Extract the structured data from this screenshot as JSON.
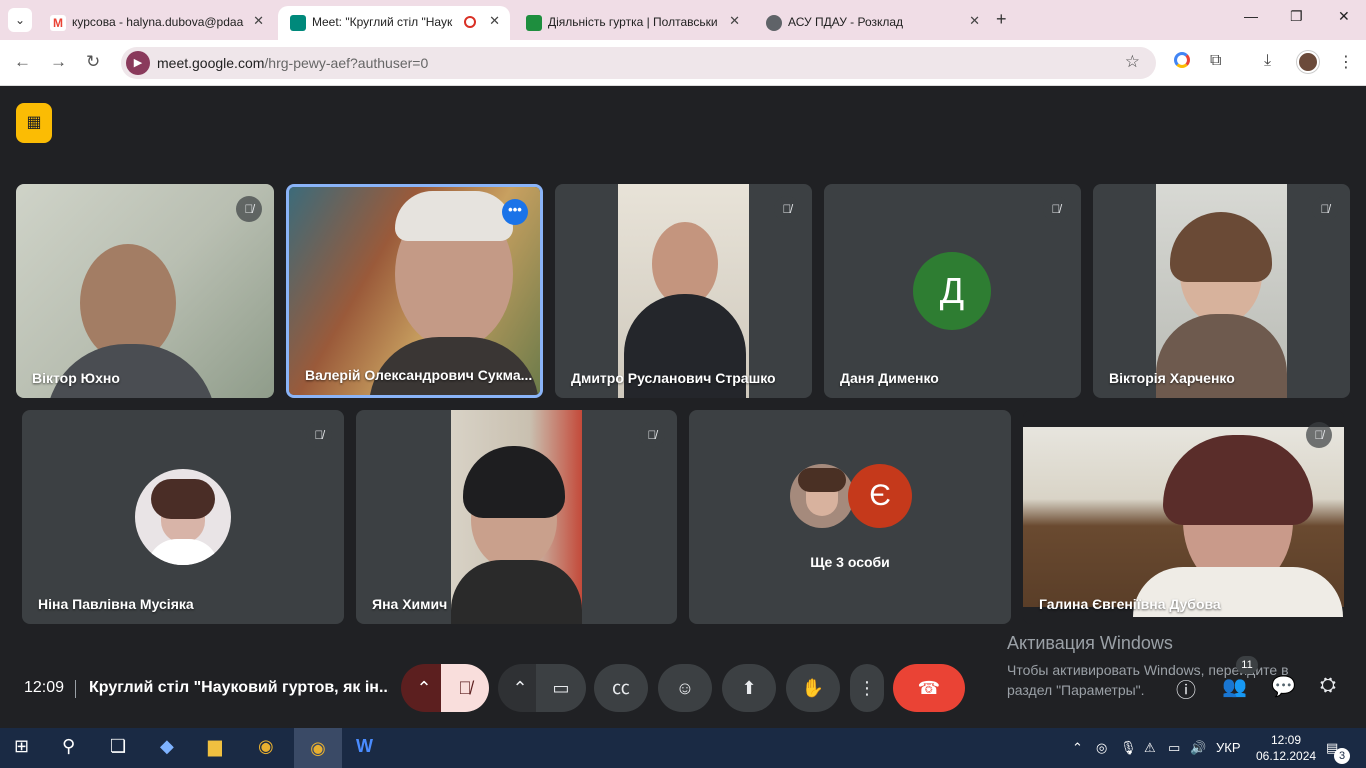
{
  "browser": {
    "tabs": [
      {
        "title": "курсова - halyna.dubova@pdaa",
        "favicon": "gmail-icon",
        "color": "#ea4335",
        "active": false
      },
      {
        "title": "Meet: \"Круглий стіл \"Наук",
        "favicon": "meet-icon",
        "color": "#00897b",
        "active": true
      },
      {
        "title": "Діяльність гуртка | Полтавськи",
        "favicon": "sites-icon",
        "color": "#1e8e3e",
        "active": false
      },
      {
        "title": "АСУ ПДАУ - Розклад",
        "favicon": "globe-icon",
        "color": "#5f6368",
        "active": false
      }
    ],
    "url_host": "meet.google.com",
    "url_path": "/hrg-pewy-aef?authuser=0"
  },
  "participants": [
    {
      "name": "Віктор Юхно",
      "muted": true
    },
    {
      "name": "Валерій Олександрович Сукма...",
      "muted": false,
      "selected": true
    },
    {
      "name": "Дмитро Русланович Страшко",
      "muted": true
    },
    {
      "name": "Даня Дименко",
      "muted": true,
      "avatar_letter": "Д",
      "avatar_color": "#2e7d32"
    },
    {
      "name": "Вікторія Харченко",
      "muted": true
    },
    {
      "name": "Ніна Павлівна Мусіяка",
      "muted": true
    },
    {
      "name": "Яна Химич",
      "muted": true
    },
    {
      "name": "Галина Євгеніївна Дубова",
      "muted": true
    }
  ],
  "overflow": {
    "label": "Ще 3 особи",
    "avatar_letter": "Є",
    "avatar_color": "#c5391b"
  },
  "windows_activation": {
    "title": "Активация Windows",
    "line1": "Чтобы активировать Windows, перейдите в",
    "line2": "раздел \"Параметры\"."
  },
  "meeting": {
    "clock": "12:09",
    "title": "Круглий стіл \"Науковий гуртов, як ін..."
  },
  "people_count": "11",
  "taskbar": {
    "lang": "УКР",
    "time": "12:09",
    "date": "06.12.2024",
    "notifications": "3"
  }
}
